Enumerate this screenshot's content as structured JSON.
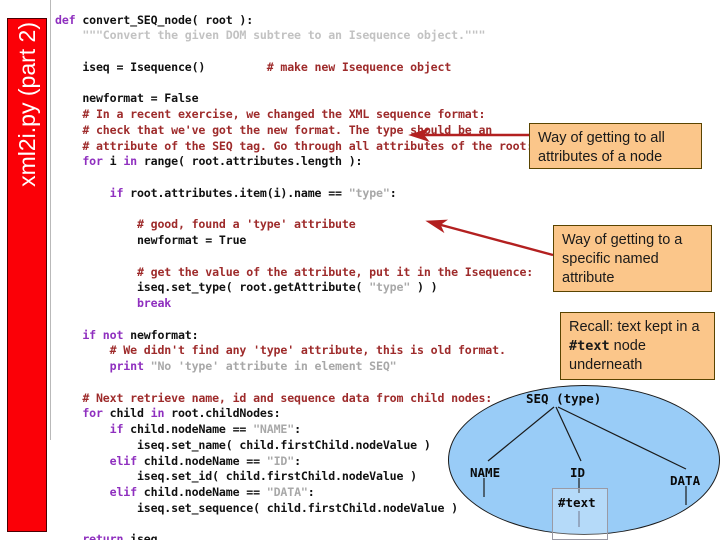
{
  "slide": {
    "sidebar_label": "xml2i.py (part 2)",
    "sidebar_color": "#fb0007"
  },
  "code": {
    "language": "python",
    "lines": [
      [
        {
          "t": "def ",
          "c": "kw"
        },
        {
          "t": "convert_SEQ_node( root ):",
          "c": "id"
        }
      ],
      [
        {
          "t": "    \"\"\"Convert the given DOM subtree to an Isequence object.\"\"\"",
          "c": "doc"
        }
      ],
      [
        {
          "t": "",
          "c": "id"
        }
      ],
      [
        {
          "t": "    iseq = Isequence()         ",
          "c": "id"
        },
        {
          "t": "# make new Isequence object",
          "c": "cm"
        }
      ],
      [
        {
          "t": "",
          "c": "id"
        }
      ],
      [
        {
          "t": "    newformat = ",
          "c": "id"
        },
        {
          "t": "False",
          "c": "id"
        }
      ],
      [
        {
          "t": "    # In a recent exercise, we changed the XML sequence format:",
          "c": "cm"
        }
      ],
      [
        {
          "t": "    # check that we've got the new format. The type should be an",
          "c": "cm"
        }
      ],
      [
        {
          "t": "    # attribute of the SEQ tag. Go through all attributes of the root:",
          "c": "cm"
        }
      ],
      [
        {
          "t": "    for ",
          "c": "kw"
        },
        {
          "t": "i ",
          "c": "id"
        },
        {
          "t": "in ",
          "c": "kw"
        },
        {
          "t": "range( root.attributes.length ):",
          "c": "id"
        }
      ],
      [
        {
          "t": "",
          "c": "id"
        }
      ],
      [
        {
          "t": "        if ",
          "c": "kw"
        },
        {
          "t": "root.attributes.item(i).name == ",
          "c": "id"
        },
        {
          "t": "\"type\"",
          "c": "st"
        },
        {
          "t": ":",
          "c": "id"
        }
      ],
      [
        {
          "t": "",
          "c": "id"
        }
      ],
      [
        {
          "t": "            # good, found a 'type' attribute",
          "c": "cm"
        }
      ],
      [
        {
          "t": "            newformat = ",
          "c": "id"
        },
        {
          "t": "True",
          "c": "id"
        }
      ],
      [
        {
          "t": "",
          "c": "id"
        }
      ],
      [
        {
          "t": "            # get the value of the attribute, put it in the Isequence:",
          "c": "cm"
        }
      ],
      [
        {
          "t": "            iseq.set_type( root.getAttribute( ",
          "c": "id"
        },
        {
          "t": "\"type\"",
          "c": "st"
        },
        {
          "t": " ) )",
          "c": "id"
        }
      ],
      [
        {
          "t": "            break",
          "c": "kw"
        }
      ],
      [
        {
          "t": "",
          "c": "id"
        }
      ],
      [
        {
          "t": "    if not ",
          "c": "kw"
        },
        {
          "t": "newformat:",
          "c": "id"
        }
      ],
      [
        {
          "t": "        # We didn't find any 'type' attribute, this is old format.",
          "c": "cm"
        }
      ],
      [
        {
          "t": "        print ",
          "c": "kw"
        },
        {
          "t": "\"No 'type' attribute in element SEQ\"",
          "c": "st"
        }
      ],
      [
        {
          "t": "",
          "c": "id"
        }
      ],
      [
        {
          "t": "    # Next retrieve name, id and sequence data from child nodes:",
          "c": "cm"
        }
      ],
      [
        {
          "t": "    for ",
          "c": "kw"
        },
        {
          "t": "child ",
          "c": "id"
        },
        {
          "t": "in ",
          "c": "kw"
        },
        {
          "t": "root.childNodes:",
          "c": "id"
        }
      ],
      [
        {
          "t": "        if ",
          "c": "kw"
        },
        {
          "t": "child.nodeName == ",
          "c": "id"
        },
        {
          "t": "\"NAME\"",
          "c": "st"
        },
        {
          "t": ":",
          "c": "id"
        }
      ],
      [
        {
          "t": "            iseq.set_name( child.firstChild.nodeValue )",
          "c": "id"
        }
      ],
      [
        {
          "t": "        elif ",
          "c": "kw"
        },
        {
          "t": "child.nodeName == ",
          "c": "id"
        },
        {
          "t": "\"ID\"",
          "c": "st"
        },
        {
          "t": ":",
          "c": "id"
        }
      ],
      [
        {
          "t": "            iseq.set_id( child.firstChild.nodeValue )",
          "c": "id"
        }
      ],
      [
        {
          "t": "        elif ",
          "c": "kw"
        },
        {
          "t": "child.nodeName == ",
          "c": "id"
        },
        {
          "t": "\"DATA\"",
          "c": "st"
        },
        {
          "t": ":",
          "c": "id"
        }
      ],
      [
        {
          "t": "            iseq.set_sequence( child.firstChild.nodeValue )",
          "c": "id"
        }
      ],
      [
        {
          "t": "",
          "c": "id"
        }
      ],
      [
        {
          "t": "    return ",
          "c": "kw"
        },
        {
          "t": "iseq",
          "c": "id"
        }
      ]
    ]
  },
  "callouts": [
    {
      "id": "callout-1",
      "text": "Way of getting to all attributes of a node"
    },
    {
      "id": "callout-2",
      "text": "Way of getting to a specific named attribute"
    },
    {
      "id": "callout-3",
      "pre": "Recall: text kept in a ",
      "mono": "#text",
      "post": " node underneath"
    }
  ],
  "tree": {
    "root_label": "SEQ (type)",
    "children": [
      "NAME",
      "ID",
      "DATA"
    ],
    "grandchild_label": "#text",
    "ellipse_color": "#99ccf7"
  }
}
